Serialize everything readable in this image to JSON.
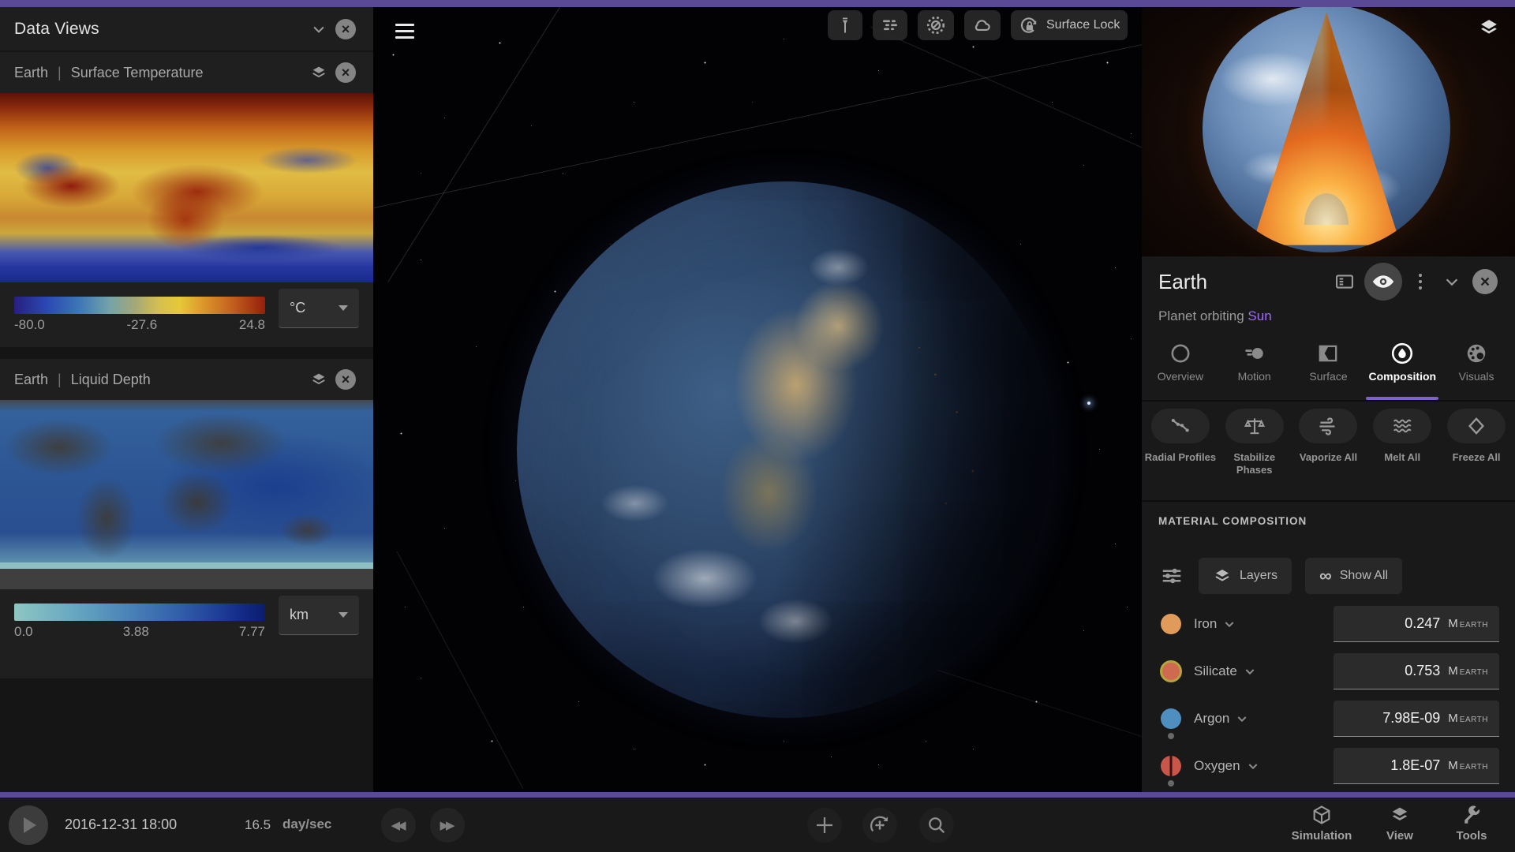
{
  "colors": {
    "accent_purple": "#5a4a96",
    "tab_underline": "#7c62c9",
    "sun_link": "#9d6ef0"
  },
  "data_views": {
    "title": "Data Views",
    "panels": [
      {
        "object": "Earth",
        "sep": "|",
        "metric": "Surface Temperature",
        "colorbar": {
          "labels": [
            "-80.0",
            "-27.6",
            "24.8"
          ],
          "unit": "°C",
          "gradient_stops": [
            "#27207f",
            "#3d77b5",
            "#a4a878",
            "#e6c838",
            "#d98f28",
            "#941f0c"
          ]
        }
      },
      {
        "object": "Earth",
        "sep": "|",
        "metric": "Liquid Depth",
        "colorbar": {
          "labels": [
            "0.0",
            "3.88",
            "7.77"
          ],
          "unit": "km",
          "gradient_stops": [
            "#8ec6c2",
            "#4a84b8",
            "#16308e",
            "#0a1c6e"
          ]
        }
      }
    ]
  },
  "viewport": {
    "surface_lock_label": "Surface Lock"
  },
  "object_panel": {
    "title": "Earth",
    "subtitle_prefix": "Planet orbiting ",
    "subtitle_link": "Sun",
    "tabs": [
      {
        "label": "Overview"
      },
      {
        "label": "Motion"
      },
      {
        "label": "Surface"
      },
      {
        "label": "Composition"
      },
      {
        "label": "Visuals"
      }
    ],
    "active_tab": "Composition",
    "actions": [
      {
        "label": "Radial Profiles"
      },
      {
        "label": "Stabilize Phases"
      },
      {
        "label": "Vaporize All"
      },
      {
        "label": "Melt All"
      },
      {
        "label": "Freeze All"
      }
    ],
    "section_title": "MATERIAL COMPOSITION",
    "layers_button": "Layers",
    "show_all_button": "Show All",
    "materials": [
      {
        "name": "Iron",
        "value": "0.247",
        "unit": "M",
        "unit_sub": "EARTH",
        "color": "#e09a5a"
      },
      {
        "name": "Silicate",
        "value": "0.753",
        "unit": "M",
        "unit_sub": "EARTH",
        "color": "#cf6a50"
      },
      {
        "name": "Argon",
        "value": "7.98E-09",
        "unit": "M",
        "unit_sub": "EARTH",
        "color": "#4e8fc0"
      },
      {
        "name": "Oxygen",
        "value": "1.8E-07",
        "unit": "M",
        "unit_sub": "EARTH",
        "color": "#c9564a"
      }
    ]
  },
  "timebar": {
    "datetime": "2016-12-31 18:00",
    "speed_value": "16.5",
    "speed_unit": "day/sec",
    "menus": [
      {
        "label": "Simulation"
      },
      {
        "label": "View"
      },
      {
        "label": "Tools"
      }
    ]
  }
}
